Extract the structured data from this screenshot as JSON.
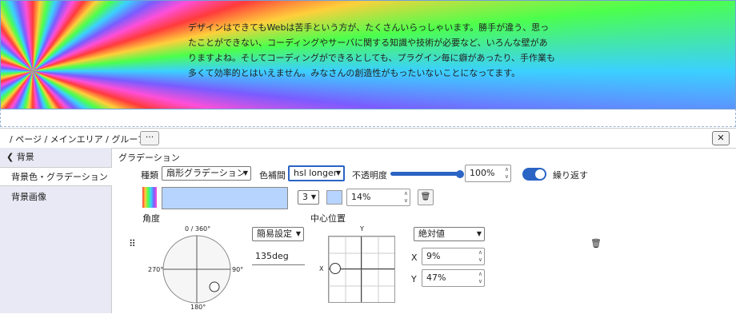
{
  "banner": {
    "text": "デザインはできてもWebは苦手という方が、たくさんいらっしゃいます。勝手が違う、思ったことができない、コーディングやサーバに関する知識や技術が必要など、いろんな壁がありますよね。そしてコーディングができるとしても、プラグイン毎に癖があったり、手作業も多くて効率的とはいえません。みなさんの創造性がもったいないことになってます。"
  },
  "breadcrumb": "/ ページ / メインエリア / グループ",
  "more_label": "···",
  "close_label": "✕",
  "sidebar": {
    "items": [
      {
        "label": "背景"
      },
      {
        "label": "背景色・グラデーション"
      },
      {
        "label": "背景画像"
      }
    ]
  },
  "gradient": {
    "section_title": "グラデーション",
    "type_label": "種類",
    "type_value": "扇形グラデーション",
    "interp_label": "色補間",
    "interp_value": "hsl longer",
    "opacity_label": "不透明度",
    "opacity_value": "100%",
    "opacity_fraction": 1.0,
    "repeat_label": "繰り返す",
    "repeat_on": true,
    "stop_index": "3",
    "stop_color": "#b7d4ff",
    "stop_position": "14%",
    "angle_label": "角度",
    "angle_ticks": {
      "top": "0 / 360°",
      "right": "90°",
      "bottom": "180°",
      "left": "270°"
    },
    "angle_preset": "簡易設定",
    "angle_value": "135deg",
    "center_label": "中心位置",
    "axis_x": "X",
    "axis_y": "Y",
    "unit_mode": "絶対値",
    "x_label": "X",
    "x_value": "9%",
    "y_label": "Y",
    "y_value": "47%"
  },
  "icons": {
    "back": "chevron-left-icon",
    "drag": "drag-handle-icon",
    "trash": "trash-icon"
  },
  "colors": {
    "accent": "#2a64c4",
    "sidebar_bg": "#e8e9f4"
  }
}
